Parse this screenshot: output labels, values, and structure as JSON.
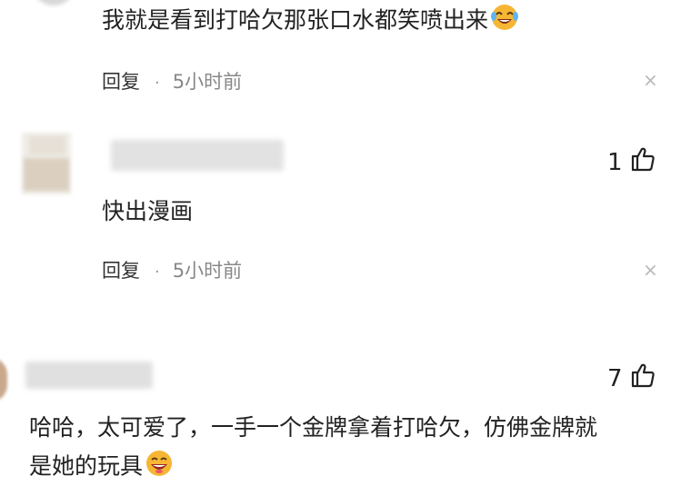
{
  "comments": [
    {
      "text": "我就是看到打哈欠那张口水都笑喷出来",
      "emoji": "laughing-tears",
      "reply_label": "回复",
      "separator": "·",
      "time": "5小时前",
      "close_glyph": "×"
    },
    {
      "like_count": "1",
      "text": "快出漫画",
      "reply_label": "回复",
      "separator": "·",
      "time": "5小时前",
      "close_glyph": "×"
    },
    {
      "like_count": "7",
      "text_line1": "哈哈，太可爱了，一手一个金牌拿着打哈欠，仿佛金牌就",
      "text_line2": "是她的玩具",
      "emoji": "grinning-face"
    }
  ],
  "colors": {
    "background": "#ffffff",
    "text": "#222222",
    "muted": "#888888",
    "emoji_yellow": "#f6b634"
  }
}
